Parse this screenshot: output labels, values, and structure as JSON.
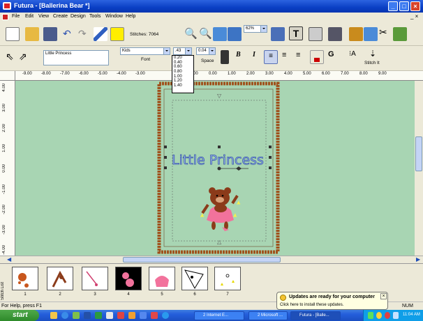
{
  "window": {
    "title": "Futura - [Ballerina Bear *]"
  },
  "menu": [
    "File",
    "Edit",
    "View",
    "Create",
    "Design",
    "Tools",
    "Window",
    "Help"
  ],
  "toolbar1": {
    "stitches": "Stitches: 7064",
    "zoom_value": "62%"
  },
  "toolbar2": {
    "text_value": "Little Princess",
    "font_value": "Kids",
    "font_label": "Font",
    "size_value": ".43",
    "space_value": "0.04",
    "space_label": "Space",
    "bold": "B",
    "italic": "I",
    "stitch_label": "Stitch It"
  },
  "size_options": [
    "0.20",
    "0.40",
    "0.60",
    "0.80",
    "1.00",
    "1.20",
    "1.40"
  ],
  "ruler_ticks": [
    "-9.00",
    "-8.00",
    "-7.00",
    "-6.00",
    "-5.00",
    "-4.00",
    "-3.00",
    "1.00",
    "0.00",
    "1.00",
    "2.00",
    "3.00",
    "4.00",
    "5.00",
    "6.00",
    "7.00",
    "8.00",
    "9.00"
  ],
  "vruler_ticks": [
    "4.00",
    "3.00",
    "2.00",
    "1.00",
    "0.00",
    "-1.00",
    "-2.00",
    "-3.00",
    "-4.00"
  ],
  "design_text": "Little Princess",
  "thumb_numbers": [
    "1",
    "2",
    "3",
    "4",
    "5",
    "6",
    "7"
  ],
  "stitch_panel_label": "Stitch List",
  "status": {
    "help": "For Help, press F1",
    "num": "NUM"
  },
  "balloon": {
    "title": "Updates are ready for your computer",
    "body": "Click here to install these updates."
  },
  "taskbar": {
    "start": "start",
    "tasks": [
      "2 Internet E...",
      "2 Microsoft ...",
      "Futura - [Balle..."
    ],
    "clock": "11:04 AM"
  },
  "colors": {
    "canvas": "#a8d5b3",
    "hoop": "#a0521d",
    "text_fill": "#9bb6ec",
    "titlebar": "#0a3fc4"
  }
}
